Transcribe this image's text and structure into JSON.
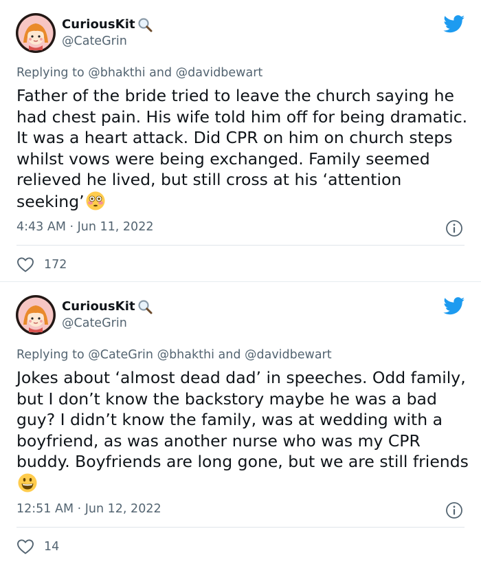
{
  "tweets": [
    {
      "author": {
        "display_name": "CuriousKit",
        "verified_emoji": "magnifying-glass-icon",
        "handle": "@CateGrin"
      },
      "replying_to": "Replying to @bhakthi and @davidbewart",
      "text": "Father of the bride tried to leave the church saying he had chest pain. His wife told him off for being dramatic. It was a heart attack. Did CPR on him on church steps whilst vows were being exchanged. Family seemed relieved he lived, but still cross at his ‘attention seeking’",
      "emoji": "flushed-face-emoji",
      "timestamp": "4:43 AM · Jun 11, 2022",
      "likes": "172"
    },
    {
      "author": {
        "display_name": "CuriousKit",
        "verified_emoji": "magnifying-glass-icon",
        "handle": "@CateGrin"
      },
      "replying_to": "Replying to @CateGrin @bhakthi and @davidbewart",
      "text": "Jokes about ‘almost dead dad’ in speeches. Odd family, but I don’t know the backstory maybe he was a bad guy? I didn’t know the family, was at wedding with a boyfriend, as was another nurse who was my CPR buddy. Boyfriends are long gone, but we are still friends",
      "emoji": "grinning-face-emoji",
      "timestamp": "12:51 AM · Jun 12, 2022",
      "likes": "14"
    }
  ],
  "colors": {
    "text_primary": "#0f1419",
    "text_secondary": "#536471",
    "twitter_blue": "#1d9bf0",
    "divider": "#dfe5ea"
  },
  "icons": [
    "twitter-bird-icon",
    "info-icon",
    "heart-icon",
    "avatar"
  ]
}
